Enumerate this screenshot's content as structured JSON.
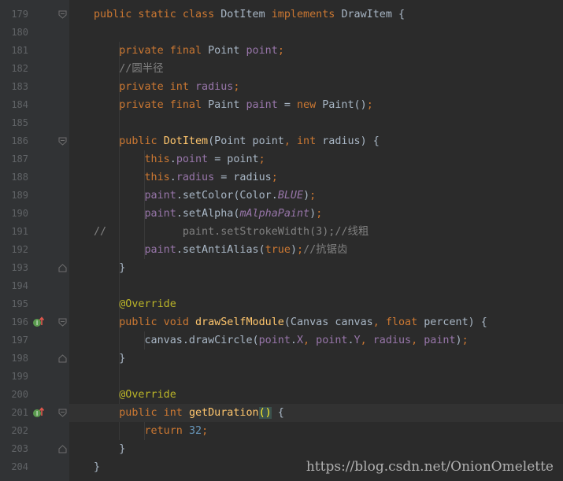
{
  "editor": {
    "lines": [
      {
        "num": "179",
        "tokens": [
          [
            "kw",
            "public static class "
          ],
          [
            "plain",
            "DotItem "
          ],
          [
            "kw",
            "implements "
          ],
          [
            "plain",
            "DrawItem {"
          ]
        ]
      },
      {
        "num": "180",
        "tokens": []
      },
      {
        "num": "181",
        "tokens": [
          [
            "kw",
            "    private final "
          ],
          [
            "plain",
            "Point "
          ],
          [
            "fld",
            "point"
          ],
          [
            "kw",
            ";"
          ]
        ]
      },
      {
        "num": "182",
        "tokens": [
          [
            "cmt",
            "    //圆半径"
          ]
        ]
      },
      {
        "num": "183",
        "tokens": [
          [
            "kw",
            "    private int "
          ],
          [
            "fld",
            "radius"
          ],
          [
            "kw",
            ";"
          ]
        ]
      },
      {
        "num": "184",
        "tokens": [
          [
            "kw",
            "    private final "
          ],
          [
            "plain",
            "Paint "
          ],
          [
            "fld",
            "paint "
          ],
          [
            "plain",
            "= "
          ],
          [
            "kw",
            "new "
          ],
          [
            "plain",
            "Paint()"
          ],
          [
            "kw",
            ";"
          ]
        ]
      },
      {
        "num": "185",
        "tokens": []
      },
      {
        "num": "186",
        "tokens": [
          [
            "kw",
            "    public "
          ],
          [
            "fn",
            "DotItem"
          ],
          [
            "plain",
            "(Point point"
          ],
          [
            "kw",
            ", int "
          ],
          [
            "plain",
            "radius) {"
          ]
        ]
      },
      {
        "num": "187",
        "tokens": [
          [
            "kw",
            "        this"
          ],
          [
            "plain",
            "."
          ],
          [
            "fld",
            "point "
          ],
          [
            "plain",
            "= point"
          ],
          [
            "kw",
            ";"
          ]
        ]
      },
      {
        "num": "188",
        "tokens": [
          [
            "kw",
            "        this"
          ],
          [
            "plain",
            "."
          ],
          [
            "fld",
            "radius "
          ],
          [
            "plain",
            "= radius"
          ],
          [
            "kw",
            ";"
          ]
        ]
      },
      {
        "num": "189",
        "tokens": [
          [
            "fld",
            "        paint"
          ],
          [
            "plain",
            ".setColor(Color."
          ],
          [
            "ifld",
            "BLUE"
          ],
          [
            "plain",
            ")"
          ],
          [
            "kw",
            ";"
          ]
        ]
      },
      {
        "num": "190",
        "tokens": [
          [
            "fld",
            "        paint"
          ],
          [
            "plain",
            ".setAlpha("
          ],
          [
            "ifld",
            "mAlphaPaint"
          ],
          [
            "plain",
            ")"
          ],
          [
            "kw",
            ";"
          ]
        ]
      },
      {
        "num": "191",
        "tokens": [
          [
            "cmt",
            "//            paint.setStrokeWidth(3);//线粗"
          ]
        ]
      },
      {
        "num": "192",
        "tokens": [
          [
            "fld",
            "        paint"
          ],
          [
            "plain",
            ".setAntiAlias("
          ],
          [
            "kw",
            "true"
          ],
          [
            "plain",
            ")"
          ],
          [
            "kw",
            ";"
          ],
          [
            "cmt",
            "//抗锯齿"
          ]
        ]
      },
      {
        "num": "193",
        "tokens": [
          [
            "plain",
            "    }"
          ]
        ]
      },
      {
        "num": "194",
        "tokens": []
      },
      {
        "num": "195",
        "tokens": [
          [
            "ann",
            "    @Override"
          ]
        ]
      },
      {
        "num": "196",
        "tokens": [
          [
            "kw",
            "    public void "
          ],
          [
            "fn",
            "drawSelfModule"
          ],
          [
            "plain",
            "(Canvas canvas"
          ],
          [
            "kw",
            ", float "
          ],
          [
            "plain",
            "percent) {"
          ]
        ]
      },
      {
        "num": "197",
        "tokens": [
          [
            "plain",
            "        canvas.drawCircle("
          ],
          [
            "fld",
            "point"
          ],
          [
            "plain",
            "."
          ],
          [
            "fld",
            "X"
          ],
          [
            "kw",
            ", "
          ],
          [
            "fld",
            "point"
          ],
          [
            "plain",
            "."
          ],
          [
            "fld",
            "Y"
          ],
          [
            "kw",
            ", "
          ],
          [
            "fld",
            "radius"
          ],
          [
            "kw",
            ", "
          ],
          [
            "fld",
            "paint"
          ],
          [
            "plain",
            ")"
          ],
          [
            "kw",
            ";"
          ]
        ]
      },
      {
        "num": "198",
        "tokens": [
          [
            "plain",
            "    }"
          ]
        ]
      },
      {
        "num": "199",
        "tokens": []
      },
      {
        "num": "200",
        "tokens": [
          [
            "ann",
            "    @Override"
          ]
        ]
      },
      {
        "num": "201",
        "tokens": [
          [
            "kw",
            "    public int "
          ],
          [
            "fn",
            "getDuration"
          ],
          [
            "brace",
            "()"
          ],
          [
            "plain",
            " {"
          ]
        ]
      },
      {
        "num": "202",
        "tokens": [
          [
            "kw",
            "        return "
          ],
          [
            "num",
            "32"
          ],
          [
            "kw",
            ";"
          ]
        ]
      },
      {
        "num": "203",
        "tokens": [
          [
            "plain",
            "    }"
          ]
        ]
      },
      {
        "num": "204",
        "tokens": [
          [
            "plain",
            "}"
          ]
        ]
      }
    ],
    "current_line": "201",
    "override_markers": [
      "196",
      "201"
    ],
    "fold_markers": [
      "179",
      "186",
      "193",
      "196",
      "198",
      "201",
      "203"
    ]
  },
  "watermark": "https://blog.csdn.net/OnionOmelette",
  "colors": {
    "background": "#2b2b2b",
    "gutter": "#313335",
    "keyword": "#cc7832",
    "field": "#9876aa",
    "method": "#ffc66d",
    "annotation": "#bbb529",
    "comment": "#808080",
    "number": "#6897bb"
  }
}
